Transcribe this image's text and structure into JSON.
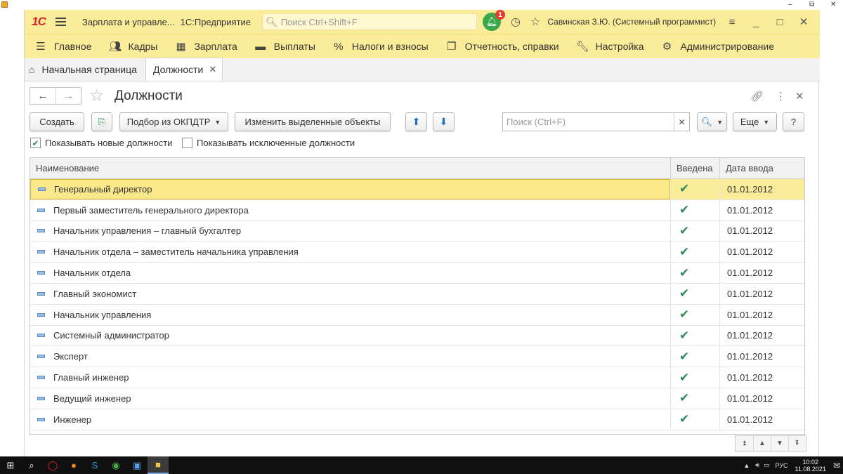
{
  "window": {
    "minimize": "–",
    "restore": "⧉",
    "close": "✕"
  },
  "titlebar": {
    "logo": "1С",
    "app_title": "Зарплата и управле...",
    "platform": "1С:Предприятие",
    "search_placeholder": "Поиск Ctrl+Shift+F",
    "notifications_count": "1",
    "user": "Савинская З.Ю. (Системный программист)"
  },
  "menu": {
    "items": [
      {
        "label": "Главное",
        "icon": "hamburger-icon"
      },
      {
        "label": "Кадры",
        "icon": "people-icon"
      },
      {
        "label": "Зарплата",
        "icon": "calculator-icon"
      },
      {
        "label": "Выплаты",
        "icon": "wallet-icon"
      },
      {
        "label": "Налоги и взносы",
        "icon": "percent-icon"
      },
      {
        "label": "Отчетность, справки",
        "icon": "reports-icon"
      },
      {
        "label": "Настройка",
        "icon": "wrench-icon"
      },
      {
        "label": "Администрирование",
        "icon": "gear-icon"
      }
    ]
  },
  "tabs": {
    "home": "Начальная страница",
    "active": "Должности"
  },
  "form": {
    "title": "Должности",
    "buttons": {
      "create": "Создать",
      "okpdtr": "Подбор из ОКПДТР",
      "change": "Изменить выделенные объекты",
      "more": "Еще",
      "help": "?"
    },
    "search_placeholder": "Поиск (Ctrl+F)",
    "checkboxes": {
      "show_new": "Показывать новые должности",
      "show_new_checked": true,
      "show_excluded": "Показывать исключенные должности",
      "show_excluded_checked": false
    }
  },
  "table": {
    "columns": [
      "Наименование",
      "Введена",
      "Дата ввода"
    ],
    "rows": [
      {
        "name": "Генеральный директор",
        "introduced": true,
        "date": "01.01.2012",
        "selected": true
      },
      {
        "name": "Первый заместитель генерального директора",
        "introduced": true,
        "date": "01.01.2012"
      },
      {
        "name": "Начальник управления – главный бухгалтер",
        "introduced": true,
        "date": "01.01.2012"
      },
      {
        "name": "Начальник отдела – заместитель начальника управления",
        "introduced": true,
        "date": "01.01.2012"
      },
      {
        "name": "Начальник отдела",
        "introduced": true,
        "date": "01.01.2012"
      },
      {
        "name": "Главный экономист",
        "introduced": true,
        "date": "01.01.2012"
      },
      {
        "name": "Начальник управления",
        "introduced": true,
        "date": "01.01.2012"
      },
      {
        "name": "Системный администратор",
        "introduced": true,
        "date": "01.01.2012"
      },
      {
        "name": "Эксперт",
        "introduced": true,
        "date": "01.01.2012"
      },
      {
        "name": "Главный инженер",
        "introduced": true,
        "date": "01.01.2012"
      },
      {
        "name": "Ведущий инженер",
        "introduced": true,
        "date": "01.01.2012"
      },
      {
        "name": "Инженер",
        "introduced": true,
        "date": "01.01.2012"
      }
    ]
  },
  "taskbar": {
    "lang": "РУС",
    "time": "10:02",
    "date": "11.08.2021"
  },
  "colors": {
    "accent_yellow": "#fbec9a",
    "check_green": "#2e8b57",
    "arrow_blue": "#1f6fc8"
  }
}
